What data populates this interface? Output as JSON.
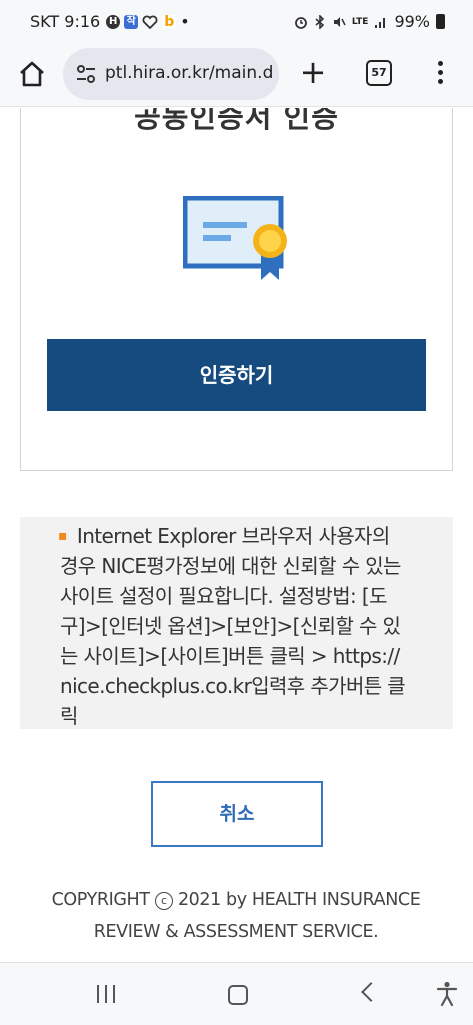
{
  "status_bar": {
    "carrier_time": "SKT 9:16",
    "app_badges": [
      "H",
      "작",
      "b"
    ],
    "dot": "•",
    "battery": "99%",
    "network": "LTE"
  },
  "browser": {
    "url": "ptl.hira.or.kr/main.d",
    "tab_count": "57",
    "new_tab_label": "+"
  },
  "card": {
    "title": "공동인증서 인증",
    "auth_button": "인증하기",
    "icon": "certificate-icon"
  },
  "notice": {
    "bullet": "▪",
    "text": "Internet Explorer 브라우저 사용자의 경우 NICE평가정보에 대한 신뢰할 수 있는 사이트 설정이 필요합니다. 설정방법: [도구]>[인터넷 옵션]>[보안]>[신뢰할 수 있는 사이트]>[사이트]버튼 클릭 > https://nice.checkplus.co.kr입력후 추가버튼 클릭"
  },
  "cancel_button": "취소",
  "footer": {
    "copyright_prefix": "COPYRIGHT",
    "copyright_symbol": "c",
    "copyright_rest": "2021 by HEALTH INSURANCE  REVIEW & ASSESSMENT SERVICE."
  },
  "colors": {
    "primary_button": "#164b7f",
    "cancel_border": "#3a78c2",
    "bullet": "#f08a1c",
    "notice_bg": "#f2f2f2"
  }
}
